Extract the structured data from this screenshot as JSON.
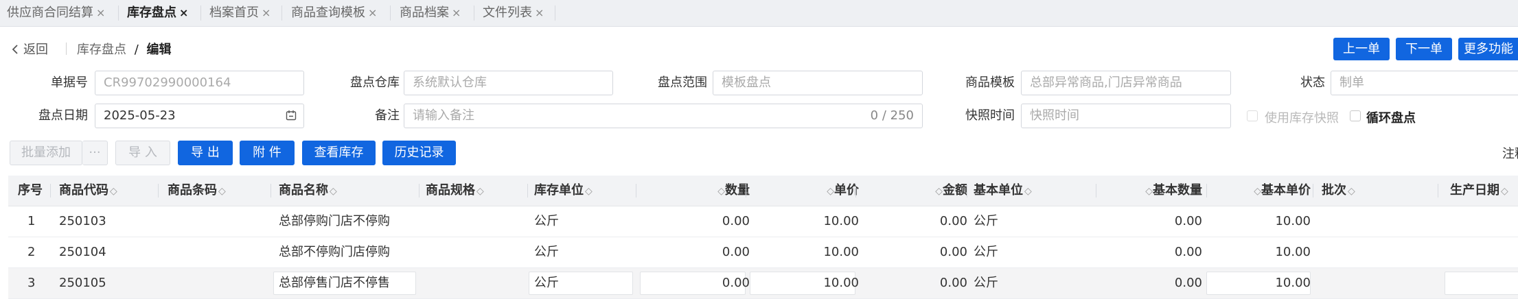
{
  "tabs": [
    {
      "label": "供应商合同结算",
      "active": false
    },
    {
      "label": "库存盘点",
      "active": true
    },
    {
      "label": "档案首页",
      "active": false
    },
    {
      "label": "商品查询模板",
      "active": false
    },
    {
      "label": "商品档案",
      "active": false
    },
    {
      "label": "文件列表",
      "active": false
    }
  ],
  "tab_close_glyph": "×",
  "header": {
    "back_label": "返回",
    "crumb_parent": "库存盘点",
    "crumb_sep": "/",
    "crumb_current": "编辑",
    "prev_label": "上一单",
    "next_label": "下一单",
    "more_label": "更多功能"
  },
  "form": {
    "doc_no": {
      "label": "单据号",
      "placeholder": "CR99702990000164"
    },
    "warehouse": {
      "label": "盘点仓库",
      "placeholder": "系统默认仓库"
    },
    "scope": {
      "label": "盘点范围",
      "placeholder": "模板盘点"
    },
    "template": {
      "label": "商品模板",
      "placeholder": "总部异常商品,门店异常商品"
    },
    "status": {
      "label": "状态",
      "placeholder": "制单"
    },
    "date": {
      "label": "盘点日期",
      "value": "2025-05-23"
    },
    "remark": {
      "label": "备注",
      "placeholder": "请输入备注",
      "count": "0 / 250"
    },
    "snapshot_time": {
      "label": "快照时间",
      "placeholder": "快照时间"
    },
    "use_snapshot": {
      "label": "使用库存快照",
      "checked": false
    },
    "cycle_count": {
      "label": "循环盘点",
      "checked": false
    }
  },
  "toolbar": {
    "batch_add": "批量添加",
    "more_dots": "···",
    "import": "导 入",
    "export": "导 出",
    "attachment": "附 件",
    "view_stock": "查看库存",
    "history": "历史记录",
    "right_note": "注释"
  },
  "table": {
    "columns": [
      "序号",
      "商品代码",
      "商品条码",
      "商品名称",
      "商品规格",
      "库存单位",
      "数量",
      "单价",
      "金额",
      "基本单位",
      "基本数量",
      "基本单价",
      "批次",
      "生产日期"
    ],
    "rows": [
      {
        "seq": "1",
        "code": "250103",
        "barcode": "",
        "name": "总部停购门店不停购",
        "spec": "",
        "unit": "公斤",
        "qty": "0.00",
        "price": "10.00",
        "amount": "0.00",
        "base_unit": "公斤",
        "base_qty": "0.00",
        "base_price": "10.00",
        "batch": "",
        "prod_date": ""
      },
      {
        "seq": "2",
        "code": "250104",
        "barcode": "",
        "name": "总部不停购门店停购",
        "spec": "",
        "unit": "公斤",
        "qty": "0.00",
        "price": "10.00",
        "amount": "0.00",
        "base_unit": "公斤",
        "base_qty": "0.00",
        "base_price": "10.00",
        "batch": "",
        "prod_date": ""
      },
      {
        "seq": "3",
        "code": "250105",
        "barcode": "",
        "name": "总部停售门店不停售",
        "spec": "",
        "unit": "公斤",
        "qty": "0.00",
        "price": "10.00",
        "amount": "0.00",
        "base_unit": "公斤",
        "base_qty": "0.00",
        "base_price": "10.00",
        "batch": "",
        "prod_date": ""
      }
    ]
  },
  "colors": {
    "primary": "#1166e0",
    "tab_bg": "#eef0f3",
    "header_bg": "#f2f3f5"
  }
}
